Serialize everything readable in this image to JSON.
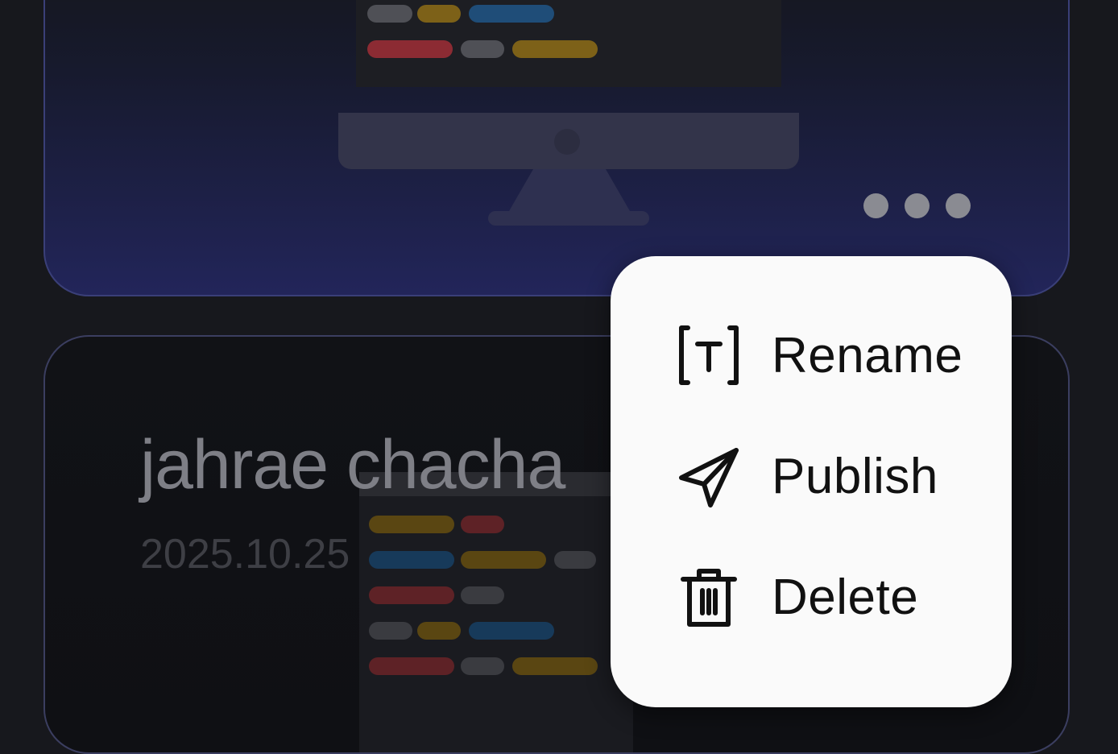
{
  "document": {
    "title": "jahrae chacha",
    "date": "2025.10.25"
  },
  "menu": {
    "items": [
      {
        "label": "Rename",
        "icon": "rename-icon"
      },
      {
        "label": "Publish",
        "icon": "publish-icon"
      },
      {
        "label": "Delete",
        "icon": "delete-icon"
      }
    ]
  },
  "colors": {
    "background": "#17181d",
    "card_border": "#3a3f78",
    "menu_background": "#fafafa",
    "code_red": "#8c2b33",
    "code_yellow": "#7d6118",
    "code_blue": "#1f4d78",
    "code_gray": "#4f5056"
  }
}
